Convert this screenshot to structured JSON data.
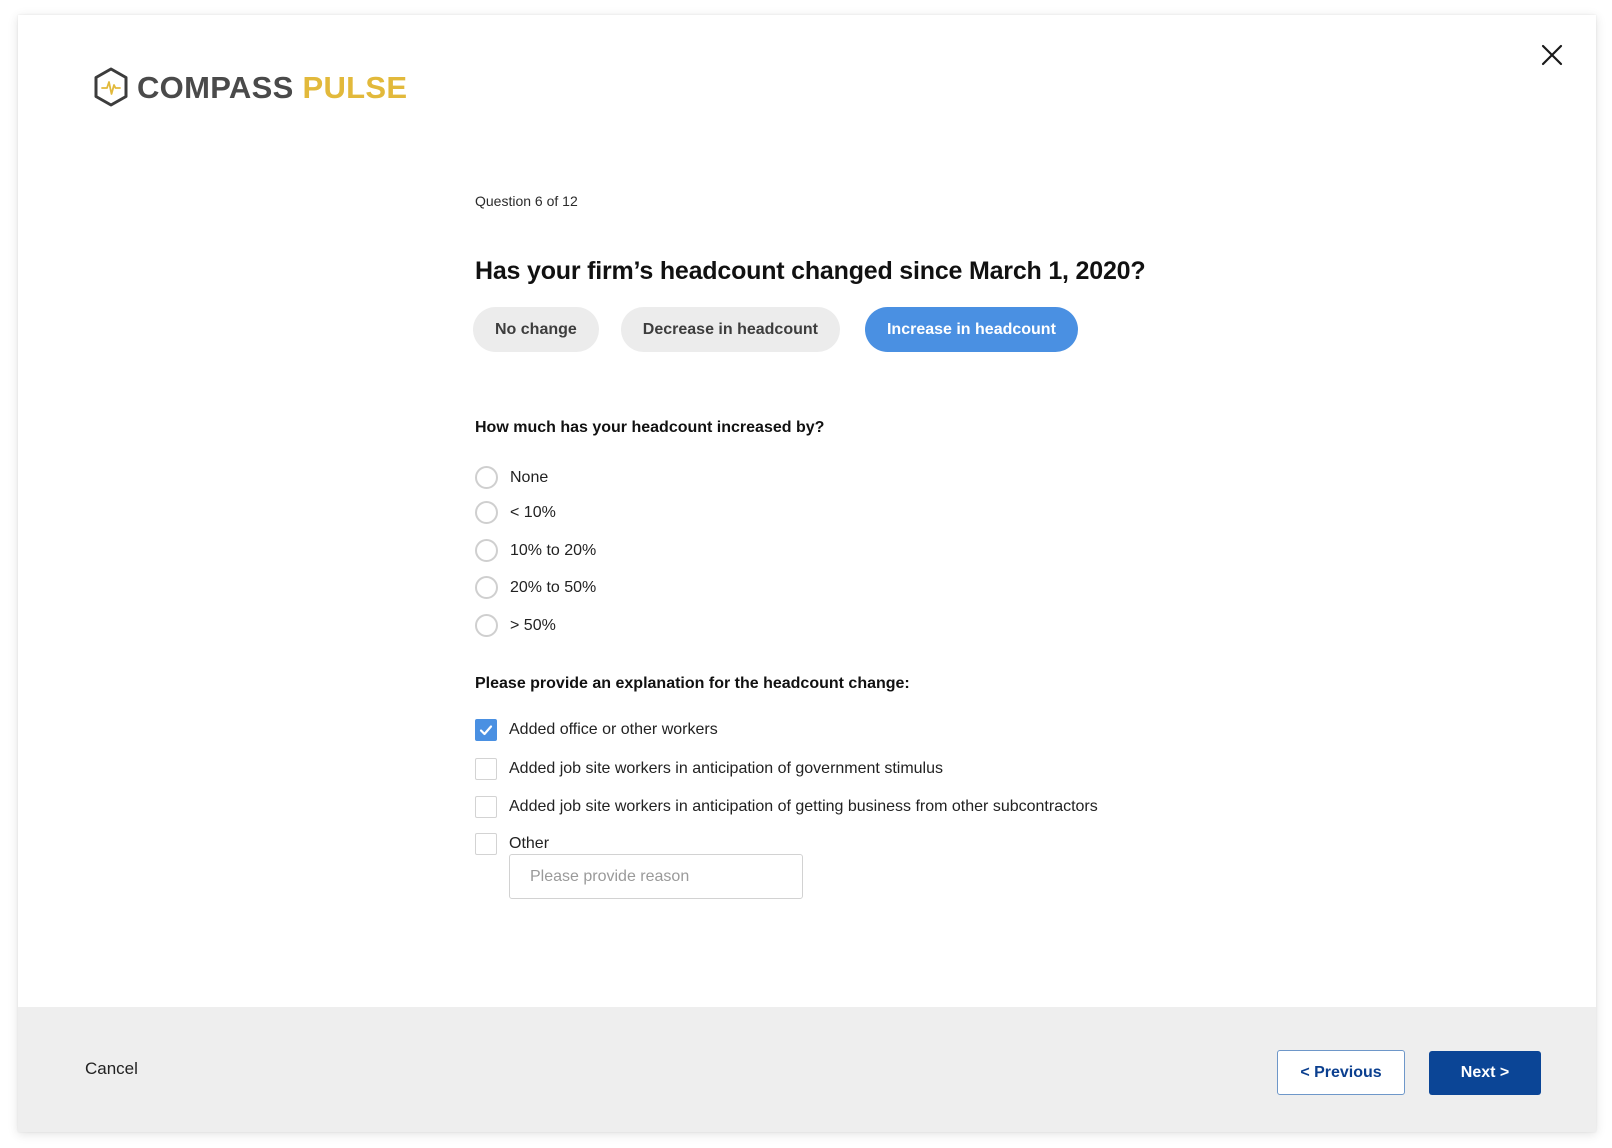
{
  "brand": {
    "name_part1": "COMPASS",
    "name_part2": "PULSE",
    "logo_icon": "hexagon-pulse-icon",
    "colors": {
      "primary_text": "#4a4a4a",
      "accent_gold": "#e2b93b"
    }
  },
  "close_icon": "close-icon",
  "question": {
    "progress": "Question 6 of 12",
    "current": 6,
    "total": 12,
    "title": "Has your firm’s headcount changed since March 1, 2020?"
  },
  "change_options": [
    {
      "label": "No change",
      "selected": false
    },
    {
      "label": "Decrease in headcount",
      "selected": false
    },
    {
      "label": "Increase in headcount",
      "selected": true
    }
  ],
  "increase_question": {
    "label": "How much has your headcount increased by?",
    "options": [
      {
        "label": "None",
        "selected": false
      },
      {
        "label": "< 10%",
        "selected": false
      },
      {
        "label": "10% to 20%",
        "selected": false
      },
      {
        "label": "20% to 50%",
        "selected": false
      },
      {
        "label": "> 50%",
        "selected": false
      }
    ]
  },
  "explanation_question": {
    "label": "Please provide an explanation for the headcount change:",
    "options": [
      {
        "label": "Added office or other workers",
        "checked": true
      },
      {
        "label": "Added job site workers in anticipation of government stimulus",
        "checked": false
      },
      {
        "label": "Added job site workers in anticipation of getting business from other subcontractors",
        "checked": false
      },
      {
        "label": "Other",
        "checked": false
      }
    ],
    "other_input": {
      "value": "",
      "placeholder": "Please provide reason"
    }
  },
  "footer": {
    "cancel_label": "Cancel",
    "previous_label": "< Previous",
    "next_label": "Next >"
  },
  "colors": {
    "active_blue": "#4a90e2",
    "primary_navy": "#0b4596",
    "pill_gray": "#ececec",
    "footer_gray": "#eeeeee"
  }
}
